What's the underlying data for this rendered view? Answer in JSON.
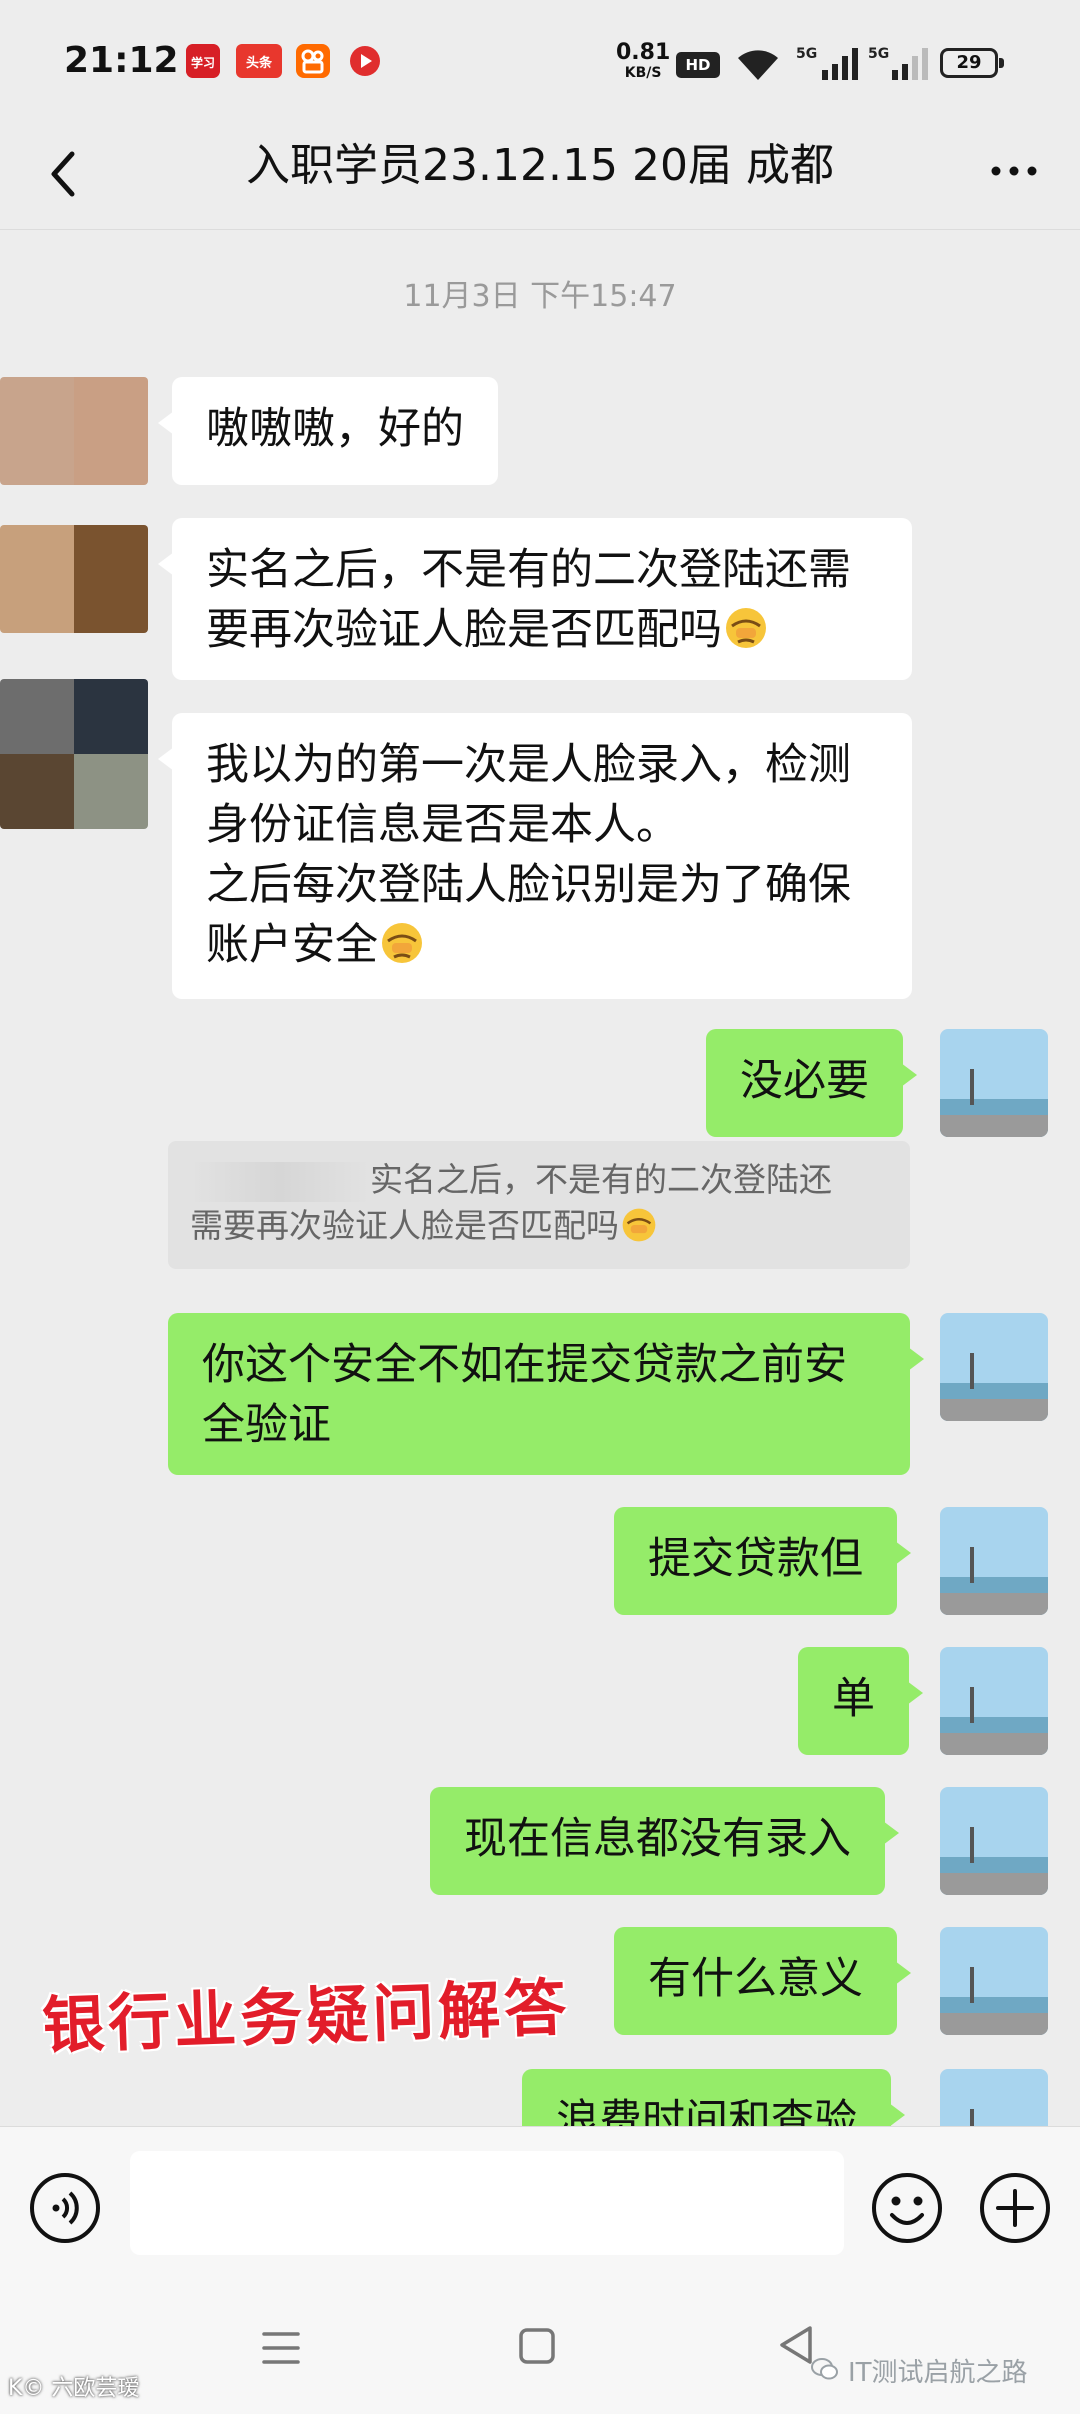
{
  "status_bar": {
    "time": "21:12",
    "speed_value": "0.81",
    "speed_unit": "KB/S",
    "hd_label": "HD",
    "signal1_label": "5G",
    "signal2_label": "5G",
    "battery": "29",
    "app_icons": [
      "学习",
      "头条",
      "快手",
      "视频"
    ]
  },
  "header": {
    "title": "入职学员23.12.15 20届 成都",
    "back_icon": "chevron-left-icon",
    "more_icon": "more-dots-icon"
  },
  "chat": {
    "timestamp": "11月3日 下午15:47",
    "messages": [
      {
        "side": "left",
        "text": "嗷嗷嗷，好的"
      },
      {
        "side": "left",
        "text_line1": "实名之后，不是有的二次登陆还需",
        "text_line2": "要再次验证人脸是否匹配吗"
      },
      {
        "side": "left",
        "text_line1": "我以为的第一次是人脸录入，检测",
        "text_line2": "身份证信息是否是本人。",
        "text_line3": "之后每次登陆人脸识别是为了确保",
        "text_line4": "账户安全"
      },
      {
        "side": "right",
        "text": "没必要"
      },
      {
        "side": "right",
        "text_line1": "你这个安全不如在提交贷款之前安",
        "text_line2": "全验证"
      },
      {
        "side": "right",
        "text": "提交贷款但"
      },
      {
        "side": "right",
        "text": "单"
      },
      {
        "side": "right",
        "text": "现在信息都没有录入"
      },
      {
        "side": "right",
        "text": "有什么意义"
      },
      {
        "side": "right",
        "text": "浪费时间和查验"
      }
    ],
    "quote": {
      "line1": "实名之后，不是有的二次登陆还",
      "line2": "需要再次验证人脸是否匹配吗"
    },
    "overlay_caption": "银行业务疑问解答"
  },
  "input_bar": {
    "placeholder": "",
    "voice_icon": "voice-icon",
    "emoji_icon": "emoji-icon",
    "plus_icon": "plus-icon"
  },
  "nav_bar": {
    "watermark_left": "K© 六欧芸瑷",
    "watermark_right": "IT测试启航之路"
  },
  "colors": {
    "background": "#ededed",
    "bubble_self": "#95ec69",
    "bubble_other": "#ffffff",
    "caption_red": "#e21d2a"
  }
}
